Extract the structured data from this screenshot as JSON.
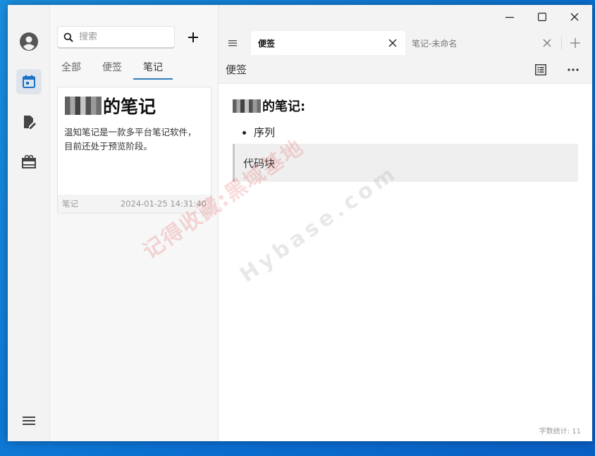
{
  "window": {
    "controls": {
      "minimize": "minimize-icon",
      "maximize": "maximize-icon",
      "close": "close-icon"
    }
  },
  "rail": {
    "items": [
      {
        "icon": "account-icon",
        "active": false
      },
      {
        "icon": "calendar-icon",
        "active": true
      },
      {
        "icon": "edit-note-icon",
        "active": false
      },
      {
        "icon": "gift-icon",
        "active": false
      }
    ],
    "bottom_icon": "menu-icon"
  },
  "list": {
    "search": {
      "placeholder": "搜索",
      "value": ""
    },
    "add_icon": "plus-icon",
    "filters": [
      "全部",
      "便签",
      "笔记"
    ],
    "active_filter": "笔记",
    "cards": [
      {
        "title_suffix": "的笔记",
        "body": "温知笔记是一款多平台笔记软件，目前还处于预览阶段。",
        "type": "笔记",
        "date": "2024-01-25 14:31:40"
      }
    ]
  },
  "tabs": [
    {
      "label": "便签",
      "active": true
    },
    {
      "label": "笔记-未命名",
      "active": false
    }
  ],
  "toolbar": {
    "title": "便签",
    "outline_icon": "outline-icon",
    "more_icon": "more-icon"
  },
  "doc": {
    "heading_suffix": "的笔记:",
    "list_items": [
      "序列"
    ],
    "code_text": "代码块"
  },
  "status": {
    "word_count": "字数统计: 11"
  },
  "watermarks": [
    "记得收藏:黑域基地",
    "Hybase.com"
  ],
  "colors": {
    "accent": "#2f7fb8",
    "calendar": "#1a73c8",
    "watermark": "#e25656"
  }
}
